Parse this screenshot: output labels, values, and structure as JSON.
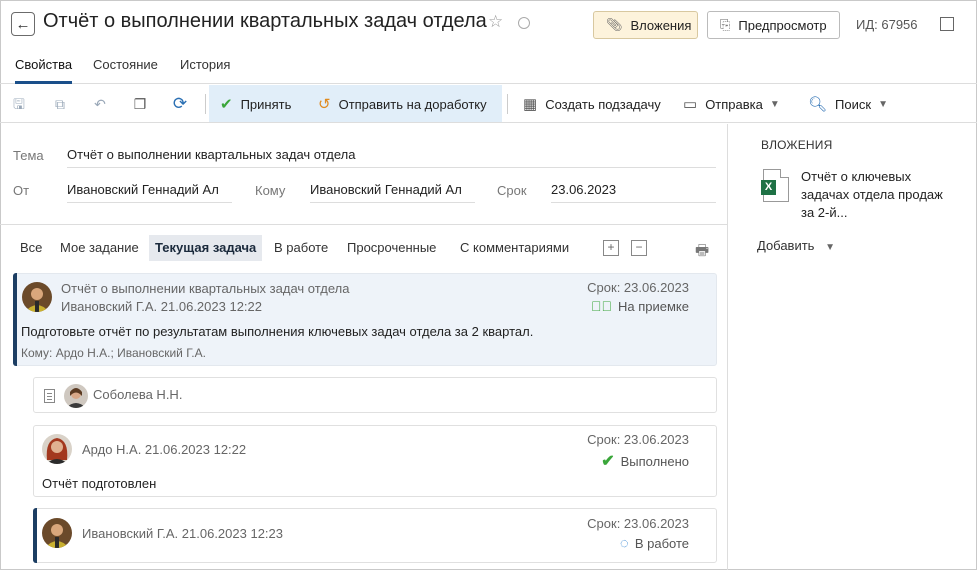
{
  "header": {
    "title": "Отчёт о выполнении квартальных задач отдела",
    "attachments_label": "Вложения",
    "preview_label": "Предпросмотр",
    "doc_id": "ИД: 67956"
  },
  "tabs": [
    {
      "label": "Свойства",
      "active": true
    },
    {
      "label": "Состояние",
      "active": false
    },
    {
      "label": "История",
      "active": false
    }
  ],
  "toolbar": {
    "accept": "Принять",
    "send_back": "Отправить на доработку",
    "create_subtask": "Создать подзадачу",
    "send": "Отправка",
    "search": "Поиск"
  },
  "form": {
    "subject_label": "Тема",
    "subject": "Отчёт о выполнении квартальных задач отдела",
    "from_label": "От",
    "from": "Ивановский Геннадий Ал",
    "to_label": "Кому",
    "to": "Ивановский Геннадий Ал",
    "due_label": "Срок",
    "due": "23.06.2023"
  },
  "attachments_panel": {
    "heading": "ВЛОЖЕНИЯ",
    "file": "Отчёт о ключевых задачах отдела продаж за 2-й...",
    "add_label": "Добавить"
  },
  "filters": [
    {
      "label": "Все",
      "active": false
    },
    {
      "label": "Мое задание",
      "active": false
    },
    {
      "label": "Текущая задача",
      "active": true
    },
    {
      "label": "В работе",
      "active": false
    },
    {
      "label": "Просроченные",
      "active": false
    },
    {
      "label": "С комментариями",
      "active": false
    }
  ],
  "cards": {
    "main": {
      "title": "Отчёт о выполнении квартальных задач отдела",
      "author_date": "Ивановский Г.А.  21.06.2023 12:22",
      "due": "Срок: 23.06.2023",
      "status": "На приемке",
      "text": "Подготовьте отчёт по результатам выполнения ключевых задач отдела за 2 квартал.",
      "recipients": "Кому: Ардо Н.А.; Ивановский Г.А."
    },
    "sobo": {
      "name": "Соболева Н.Н."
    },
    "ardo": {
      "author_date": "Ардо Н.А.  21.06.2023 12:22",
      "due": "Срок: 23.06.2023",
      "status": "Выполнено",
      "text": "Отчёт подготовлен"
    },
    "ivan": {
      "author_date": "Ивановский Г.А.  21.06.2023 12:23",
      "due": "Срок: 23.06.2023",
      "status": "В работе"
    }
  },
  "colors": {
    "accent": "#1a4f8a",
    "success": "#3aa63a",
    "highlight": "#e1eef9",
    "attach_bg": "#fdf3dc"
  }
}
